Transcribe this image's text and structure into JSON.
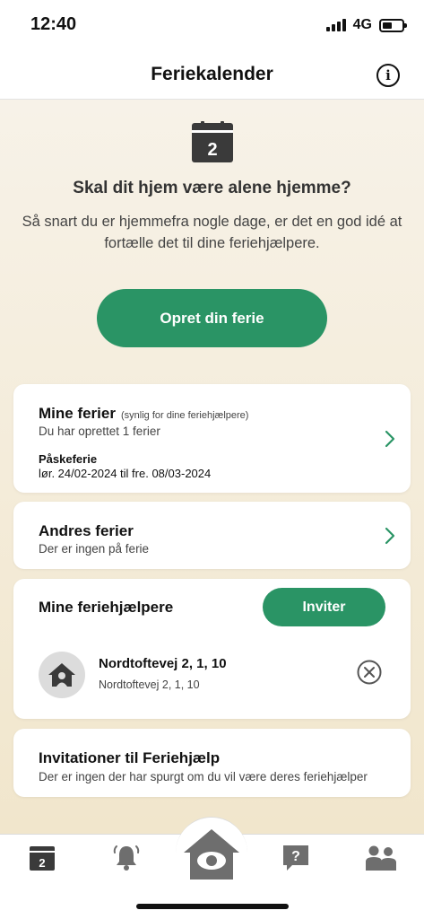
{
  "status_bar": {
    "time": "12:40",
    "network": "4G"
  },
  "header": {
    "title": "Feriekalender",
    "info_icon": "info-icon"
  },
  "hero": {
    "calendar_day": "2",
    "title": "Skal dit hjem være alene hjemme?",
    "text": "Så snart du er hjemmefra nogle dage, er det en god idé at fortælle det til dine feriehjælpere.",
    "cta_label": "Opret din ferie"
  },
  "my_holidays": {
    "title": "Mine ferier",
    "note": "(synlig for dine feriehjælpere)",
    "subtitle": "Du har oprettet 1 ferier",
    "holiday_name": "Påskeferie",
    "holiday_dates": "lør. 24/02-2024 til fre. 08/03-2024"
  },
  "others_holidays": {
    "title": "Andres ferier",
    "subtitle": "Der er ingen på ferie"
  },
  "helpers": {
    "title": "Mine feriehjælpere",
    "invite_label": "Inviter",
    "items": [
      {
        "name": "Nordtoftevej 2, 1, 10",
        "address": "Nordtoftevej 2, 1, 10"
      }
    ]
  },
  "invitations": {
    "title": "Invitationer til Feriehjælp",
    "subtitle": "Der er ingen der har spurgt om du vil være deres feriehjælper"
  },
  "tab_bar": {
    "calendar_day": "2",
    "question_mark": "?",
    "icons": [
      "calendar-icon",
      "alarm-bell-icon",
      "home-eye-icon",
      "help-icon",
      "people-icon"
    ]
  },
  "colors": {
    "accent": "#2a9465",
    "background": "#f6eedd"
  }
}
